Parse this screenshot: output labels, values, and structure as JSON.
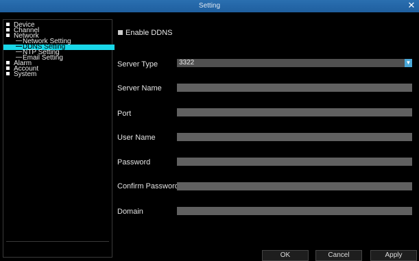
{
  "window": {
    "title": "Setting",
    "close_symbol": "✕"
  },
  "sidebar": {
    "items": [
      {
        "label": "Device",
        "level": 0
      },
      {
        "label": "Channel",
        "level": 0
      },
      {
        "label": "Network",
        "level": 0
      },
      {
        "label": "Network Setting",
        "level": 1
      },
      {
        "label": "DDNS Setting",
        "level": 1,
        "selected": true
      },
      {
        "label": "NTP Setting",
        "level": 1
      },
      {
        "label": "Email Setting",
        "level": 1
      },
      {
        "label": "Alarm",
        "level": 0
      },
      {
        "label": "Account",
        "level": 0
      },
      {
        "label": "System",
        "level": 0
      }
    ]
  },
  "ddns": {
    "enable_label": "Enable DDNS",
    "enabled": true,
    "server_type_label": "Server Type",
    "server_type_value": "3322",
    "server_name_label": "Server Name",
    "server_name_value": "",
    "port_label": "Port",
    "port_value": "",
    "user_name_label": "User Name",
    "user_name_value": "",
    "password_label": "Password",
    "password_value": "",
    "confirm_password_label": "Confirm Password",
    "confirm_password_value": "",
    "domain_label": "Domain",
    "domain_value": ""
  },
  "buttons": {
    "ok": "OK",
    "cancel": "Cancel",
    "apply": "Apply"
  },
  "colors": {
    "titlebar": "#2a6fb0",
    "selected": "#19d7e8",
    "field": "#606060"
  }
}
